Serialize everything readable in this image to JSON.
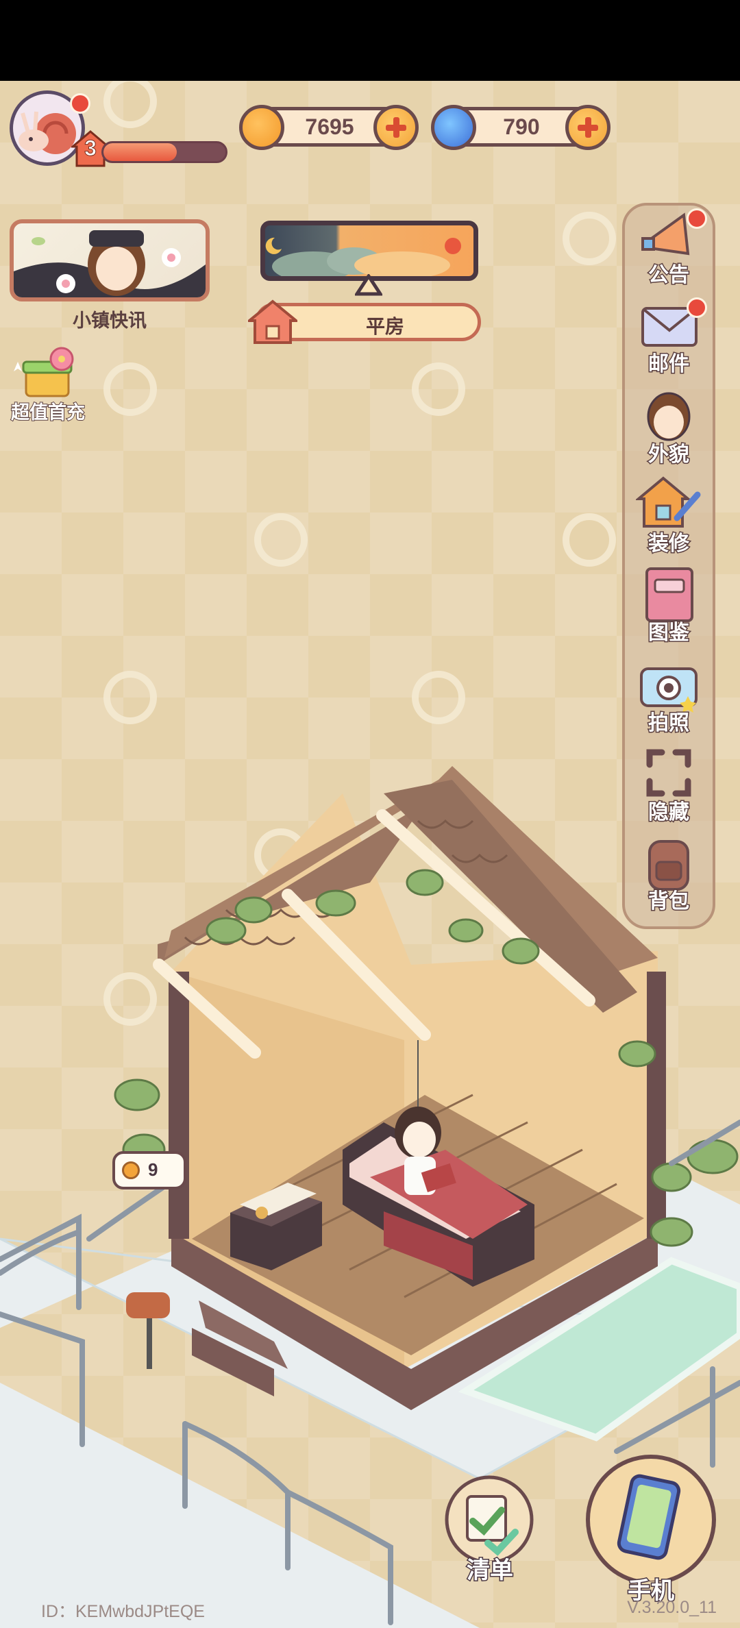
{
  "hud": {
    "level": "3",
    "xp_progress": 0.6,
    "coins": "7695",
    "gems": "790"
  },
  "news": {
    "label": "小镇快讯"
  },
  "house": {
    "type": "平房"
  },
  "recharge": {
    "label": "超值首充"
  },
  "sidebar": {
    "items": [
      {
        "label": "公告",
        "icon": "megaphone-icon",
        "badge": true
      },
      {
        "label": "邮件",
        "icon": "mail-icon",
        "badge": true
      },
      {
        "label": "外貌",
        "icon": "avatar-face-icon",
        "badge": false
      },
      {
        "label": "装修",
        "icon": "house-wrench-icon",
        "badge": false
      },
      {
        "label": "图鉴",
        "icon": "album-icon",
        "badge": false
      },
      {
        "label": "拍照",
        "icon": "camera-icon",
        "badge": false
      },
      {
        "label": "隐藏",
        "icon": "hide-frame-icon",
        "badge": false
      },
      {
        "label": "背包",
        "icon": "backpack-icon",
        "badge": false
      }
    ]
  },
  "mailbox": {
    "count": "9"
  },
  "bottom": {
    "list_label": "清单",
    "phone_label": "手机"
  },
  "footer": {
    "id": "ID：KEMwbdJPtEQE",
    "version": "V.3.20.0_11"
  },
  "colors": {
    "background": "#e6d3ac",
    "outline": "#6a4a4c",
    "accent_red": "#e84a3c",
    "coin_orange": "#f3a43a",
    "gem_blue": "#3d6fd8"
  }
}
